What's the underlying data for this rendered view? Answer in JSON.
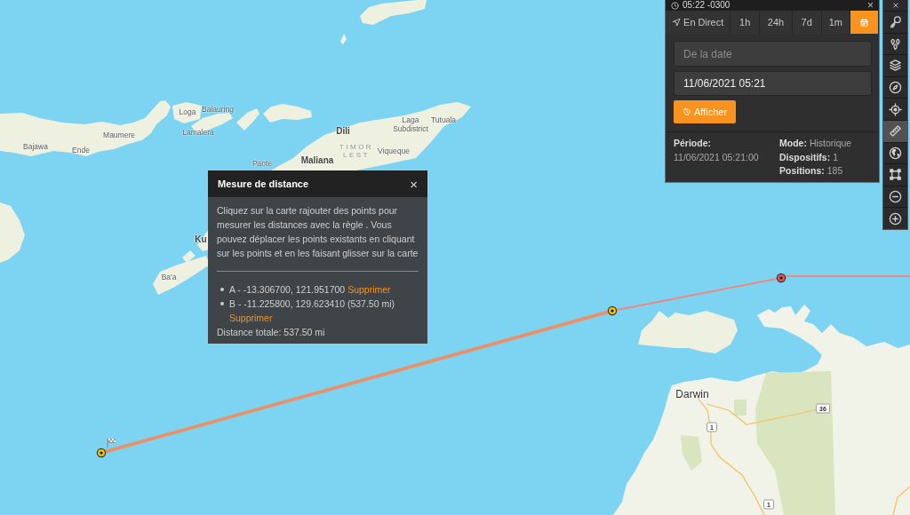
{
  "map": {
    "places": [
      {
        "text": "Loga",
        "kind": "town"
      },
      {
        "text": "Balauring",
        "kind": "town"
      },
      {
        "text": "Laga Subdistrict",
        "kind": "town"
      },
      {
        "text": "Tutuala",
        "kind": "town"
      },
      {
        "text": "Dili",
        "kind": "city"
      },
      {
        "text": "Maumere",
        "kind": "town"
      },
      {
        "text": "Lamalera",
        "kind": "town"
      },
      {
        "text": "Bajawa",
        "kind": "town"
      },
      {
        "text": "Ende",
        "kind": "town"
      },
      {
        "text": "TIMOR LEST",
        "kind": "country"
      },
      {
        "text": "Viqueque",
        "kind": "town"
      },
      {
        "text": "Maliana",
        "kind": "city"
      },
      {
        "text": "Pante",
        "kind": "town"
      },
      {
        "text": "Ku",
        "kind": "city"
      },
      {
        "text": "Ba'a",
        "kind": "town"
      },
      {
        "text": "Darwin",
        "kind": "capital"
      }
    ],
    "road_shields": [
      "36",
      "1",
      "1"
    ],
    "markers": [
      {
        "color": "#f2c100"
      },
      {
        "color": "#f2c100"
      },
      {
        "color": "#e8534c"
      }
    ]
  },
  "time_panel": {
    "time": "05:22 -0300",
    "close": "×",
    "tabs": [
      {
        "kind": "live",
        "label": "En Direct",
        "selected": false
      },
      {
        "kind": "range",
        "label": "1h",
        "selected": false
      },
      {
        "kind": "range",
        "label": "24h",
        "selected": false
      },
      {
        "kind": "range",
        "label": "7d",
        "selected": false
      },
      {
        "kind": "range",
        "label": "1m",
        "selected": false
      },
      {
        "kind": "calendar",
        "selected": true
      }
    ],
    "from_field": {
      "placeholder": "De la date"
    },
    "to_field": {
      "value": "11/06/2021 05:21"
    },
    "show_button": "Afficher",
    "period": {
      "label": "Période:",
      "value": "11/06/2021 05:21:00"
    },
    "stats": [
      {
        "label": "Mode:",
        "value": "Historique"
      },
      {
        "label": "Dispositifs:",
        "value": "1"
      },
      {
        "label": "Positions:",
        "value": "185"
      }
    ]
  },
  "toolbar": {
    "tools": [
      {
        "kind": "close",
        "selected": false
      },
      {
        "kind": "key",
        "selected": false
      },
      {
        "kind": "pins",
        "selected": false
      },
      {
        "kind": "layers",
        "selected": false
      },
      {
        "kind": "compass",
        "selected": false
      },
      {
        "kind": "locate",
        "selected": false
      },
      {
        "kind": "ruler",
        "selected": true
      },
      {
        "kind": "globe",
        "selected": false
      },
      {
        "kind": "select",
        "selected": false
      },
      {
        "kind": "zoom_out",
        "selected": false
      },
      {
        "kind": "zoom_in",
        "selected": false
      }
    ]
  },
  "distance_dialog": {
    "title": "Mesure de distance",
    "close": "×",
    "instructions": "Cliquez sur la carte rajouter des points pour mesurer les distances avec la règle . Vous pouvez déplacer les points existants en cliquant sur les points et en les faisant glisser sur la carte",
    "points": [
      {
        "text": "A - -13.306700, 121.951700",
        "action": "Supprimer"
      },
      {
        "text": "B - -11.225800, 129.623410 (537.50 mi)",
        "action": "Supprimer"
      }
    ],
    "total": "Distance totale: 537.50 mi"
  }
}
